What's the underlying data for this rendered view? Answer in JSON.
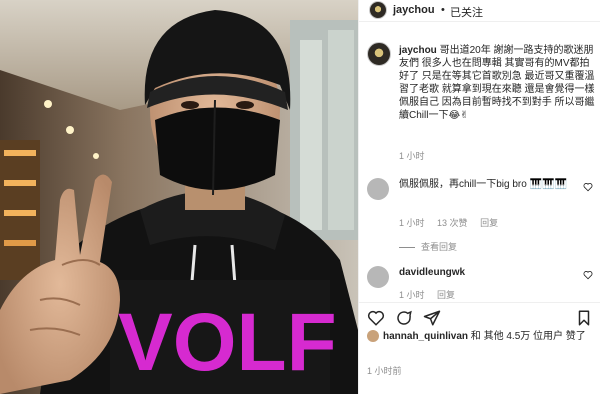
{
  "post": {
    "username": "jaychou",
    "separator": "•",
    "follow_status": "已关注",
    "caption": "哥出道20年 謝謝一路支持的歌迷朋友們 很多人也在問專輯 其實哥有的MV都拍好了 只是在等其它首歌別急 最近哥又重覆溫習了老歌 就算拿到現在來聽 還是會覺得一樣佩服自己 因為目前暫時找不到對手 所以哥繼續Chill一下😂✌",
    "caption_time": "1 小时"
  },
  "comments": [
    {
      "username": "",
      "text": "佩服佩服，再chill一下big bro 🎹🎹🎹",
      "time": "1 小时",
      "likes": "13 次赞",
      "reply": "回复",
      "view_replies": "查看回复"
    },
    {
      "username": "davidleungwk",
      "text": "",
      "time": "1 小时",
      "reply": "回复"
    }
  ],
  "likes_line": {
    "user": "hannah_quinlivan",
    "rest": "和 其他 4.5万 位用户 赞了"
  },
  "post_time": "1 小时前",
  "photo": {
    "hoodie_text": "VOLF"
  }
}
